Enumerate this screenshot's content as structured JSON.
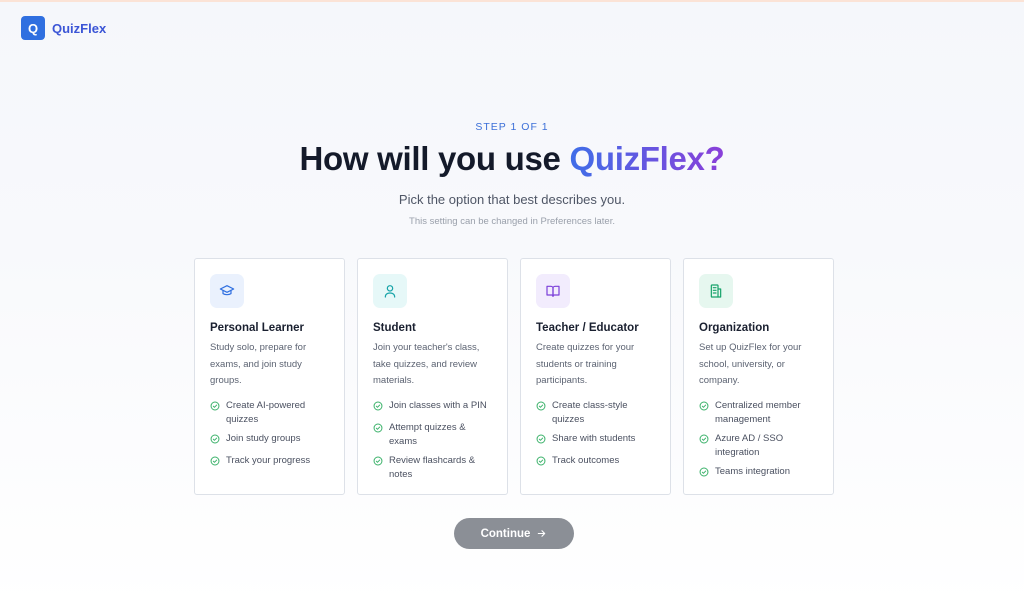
{
  "brand": {
    "logo_letter": "Q",
    "name": "QuizFlex"
  },
  "header": {
    "step": "STEP 1 OF 1",
    "title_prefix": "How will you use ",
    "title_accent": "QuizFlex?",
    "subtitle": "Pick the option that best describes you.",
    "note": "This setting can be changed in Preferences later."
  },
  "cards": [
    {
      "title": "Personal Learner",
      "icon": "graduation-cap-icon",
      "icon_color": "#2f6fe0",
      "icon_bg": "#eaf1fd",
      "description": "Study solo, prepare for exams, and join study groups.",
      "features": [
        "Create AI-powered quizzes",
        "Join study groups",
        "Track your progress"
      ]
    },
    {
      "title": "Student",
      "icon": "user-icon",
      "icon_color": "#16a3a8",
      "icon_bg": "#e6f8f8",
      "description": "Join your teacher's class, take quizzes, and review materials.",
      "features": [
        "Join classes with a PIN",
        "Attempt quizzes & exams",
        "Review flashcards & notes"
      ]
    },
    {
      "title": "Teacher / Educator",
      "icon": "book-icon",
      "icon_color": "#7b3fd9",
      "icon_bg": "#f2ecfd",
      "description": "Create quizzes for your students or training participants.",
      "features": [
        "Create class-style quizzes",
        "Share with students",
        "Track outcomes"
      ]
    },
    {
      "title": "Organization",
      "icon": "building-icon",
      "icon_color": "#16a36a",
      "icon_bg": "#e6f7ef",
      "description": "Set up QuizFlex for your school, university, or company.",
      "features": [
        "Centralized member management",
        "Azure AD / SSO integration",
        "Teams integration"
      ]
    }
  ],
  "continue_button": {
    "label": "Continue",
    "icon": "arrow-right-icon"
  },
  "colors": {
    "check": "#3bb26a",
    "button_disabled": "#8b8f96"
  }
}
